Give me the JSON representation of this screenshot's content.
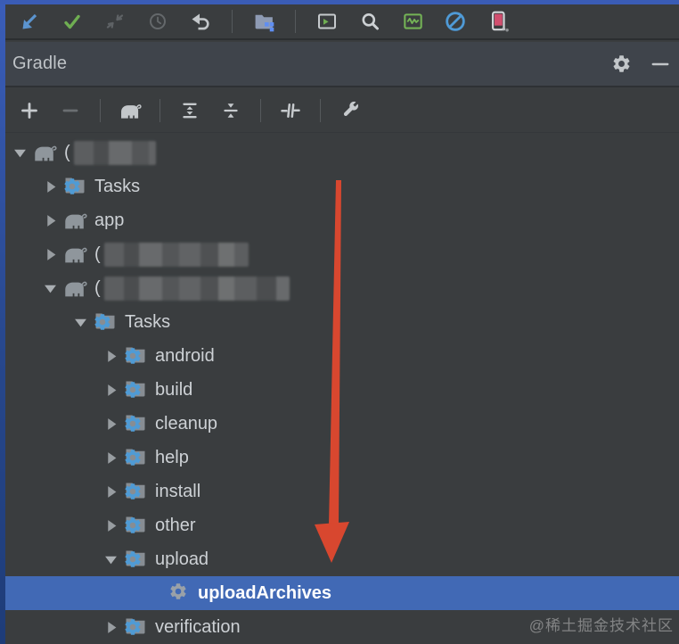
{
  "panel_header": {
    "title": "Gradle",
    "icons": [
      "settings-gear",
      "minimize"
    ]
  },
  "main_toolbar": {
    "icons": [
      "arrow-down-left",
      "checkmark",
      "merge-arrows",
      "history-clock",
      "undo-arrow",
      "project-folder",
      "run-window",
      "search",
      "profiler-monitor",
      "block-circle",
      "device-phone"
    ]
  },
  "panel_toolbar": {
    "icons": [
      "add-plus",
      "remove-minus",
      "gradle-elephant",
      "expand-all",
      "collapse-all",
      "offline-toggle",
      "wrench-settings"
    ]
  },
  "tree": {
    "rows": [
      {
        "level": 0,
        "expander": "expanded",
        "icon": "gradle",
        "label": "(",
        "censored": true,
        "censor_width": 92,
        "selected": false
      },
      {
        "level": 1,
        "expander": "collapsed",
        "icon": "task-folder",
        "label": "Tasks",
        "censored": false,
        "selected": false
      },
      {
        "level": 1,
        "expander": "collapsed",
        "icon": "gradle",
        "label": "app",
        "censored": false,
        "selected": false
      },
      {
        "level": 1,
        "expander": "collapsed",
        "icon": "gradle",
        "label": "(",
        "censored": true,
        "censor_width": 162,
        "selected": false
      },
      {
        "level": 1,
        "expander": "expanded",
        "icon": "gradle",
        "label": "(",
        "censored": true,
        "censor_width": 208,
        "selected": false
      },
      {
        "level": 2,
        "expander": "expanded",
        "icon": "task-folder",
        "label": "Tasks",
        "censored": false,
        "selected": false
      },
      {
        "level": 3,
        "expander": "collapsed",
        "icon": "task-folder",
        "label": "android",
        "censored": false,
        "selected": false
      },
      {
        "level": 3,
        "expander": "collapsed",
        "icon": "task-folder",
        "label": "build",
        "censored": false,
        "selected": false
      },
      {
        "level": 3,
        "expander": "collapsed",
        "icon": "task-folder",
        "label": "cleanup",
        "censored": false,
        "selected": false
      },
      {
        "level": 3,
        "expander": "collapsed",
        "icon": "task-folder",
        "label": "help",
        "censored": false,
        "selected": false
      },
      {
        "level": 3,
        "expander": "collapsed",
        "icon": "task-folder",
        "label": "install",
        "censored": false,
        "selected": false
      },
      {
        "level": 3,
        "expander": "collapsed",
        "icon": "task-folder",
        "label": "other",
        "censored": false,
        "selected": false
      },
      {
        "level": 3,
        "expander": "expanded",
        "icon": "task-folder",
        "label": "upload",
        "censored": false,
        "selected": false
      },
      {
        "level": 4,
        "expander": "none",
        "icon": "task-gear",
        "label": "uploadArchives",
        "censored": false,
        "selected": true
      },
      {
        "level": 3,
        "expander": "collapsed",
        "icon": "task-folder",
        "label": "verification",
        "censored": false,
        "selected": false
      }
    ]
  },
  "annotation": {
    "shape": "red-down-arrow"
  },
  "watermark": "@稀土掘金技术社区",
  "colors": {
    "selection": "#4169b5",
    "arrow_red": "#d8472f",
    "top_strip_blue": "#3a5cb5",
    "panel_bg": "#3a3d3f",
    "header_bg": "#3f444b",
    "task_gear_blue": "#4f9bd5"
  }
}
